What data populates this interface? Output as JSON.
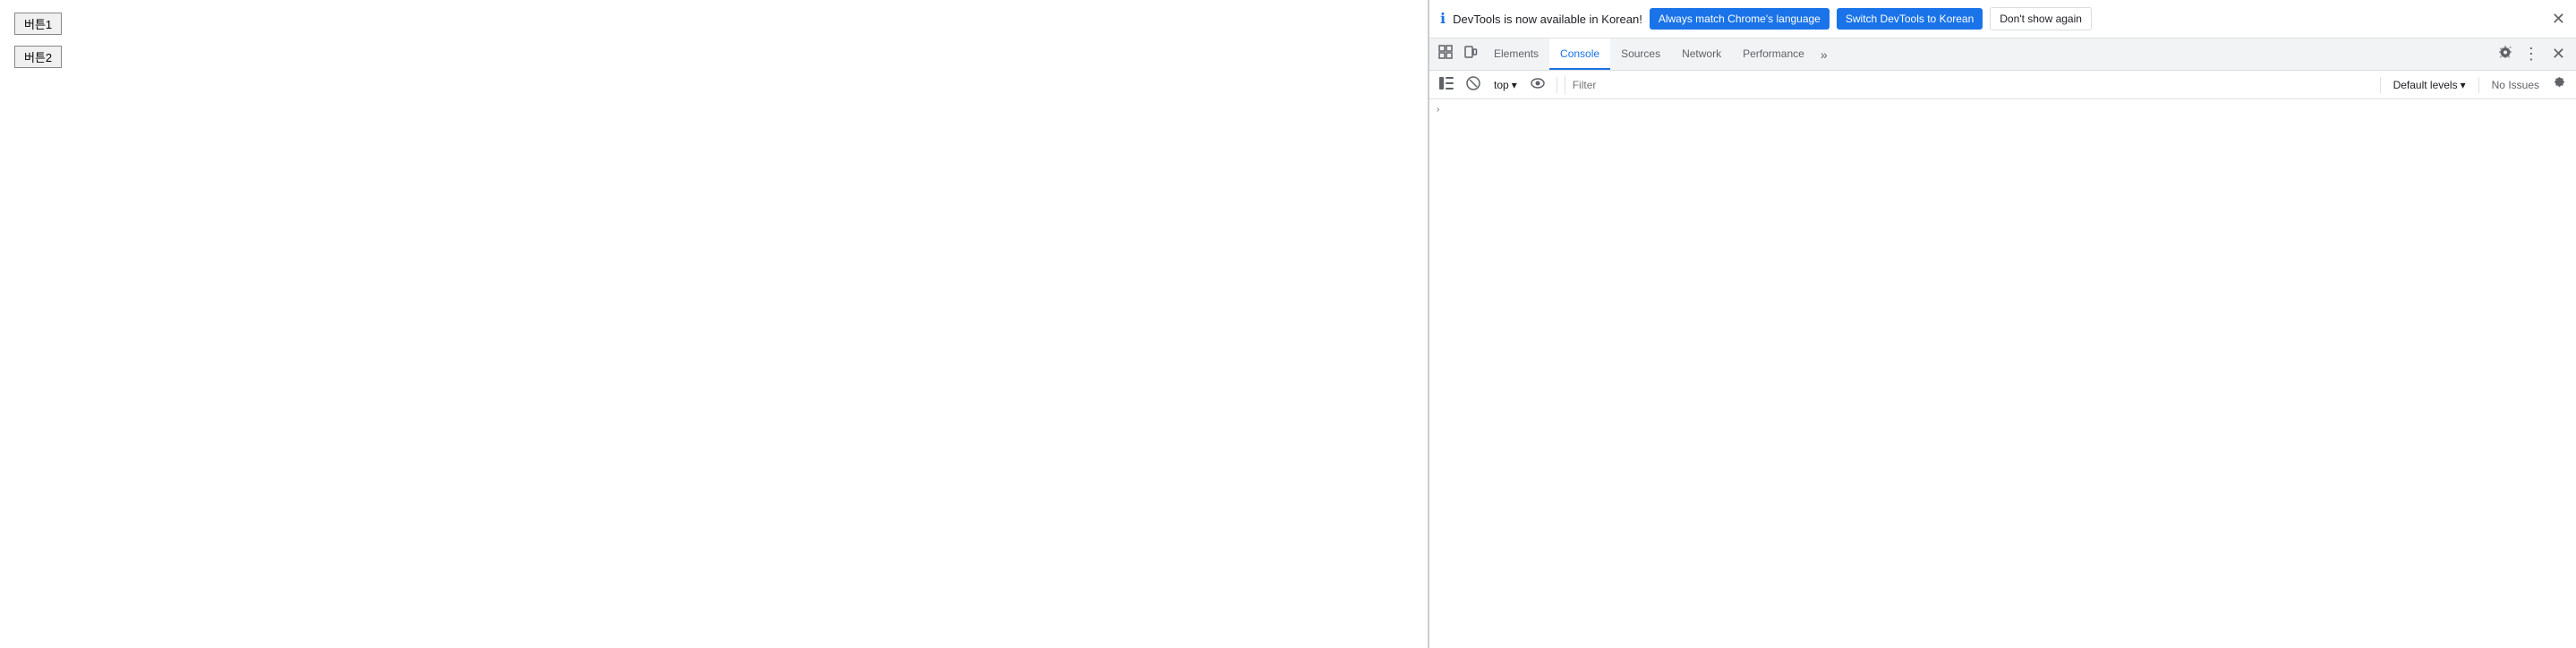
{
  "page": {
    "button1_label": "버튼1",
    "button2_label": "버튼2"
  },
  "notification": {
    "icon": "ℹ",
    "message": "DevTools is now available in Korean!",
    "btn_always_label": "Always match Chrome's language",
    "btn_switch_label": "Switch DevTools to Korean",
    "btn_dont_show_label": "Don't show again",
    "close_icon": "✕"
  },
  "tabs": {
    "inspect_icon": "⊡",
    "layout_icon": "⬚",
    "items": [
      {
        "label": "Elements",
        "active": false
      },
      {
        "label": "Console",
        "active": true
      },
      {
        "label": "Sources",
        "active": false
      },
      {
        "label": "Network",
        "active": false
      },
      {
        "label": "Performance",
        "active": false
      }
    ],
    "more_icon": "»",
    "gear_icon": "⚙",
    "dots_icon": "⋮",
    "close_icon": "✕"
  },
  "console": {
    "sidebar_icon": "≡",
    "clear_icon": "🚫",
    "context_label": "top",
    "context_arrow": "▾",
    "eye_icon": "👁",
    "filter_placeholder": "Filter",
    "levels_label": "Default levels",
    "levels_arrow": "▾",
    "no_issues_label": "No Issues",
    "gear_icon": "⚙",
    "chevron": "›"
  }
}
